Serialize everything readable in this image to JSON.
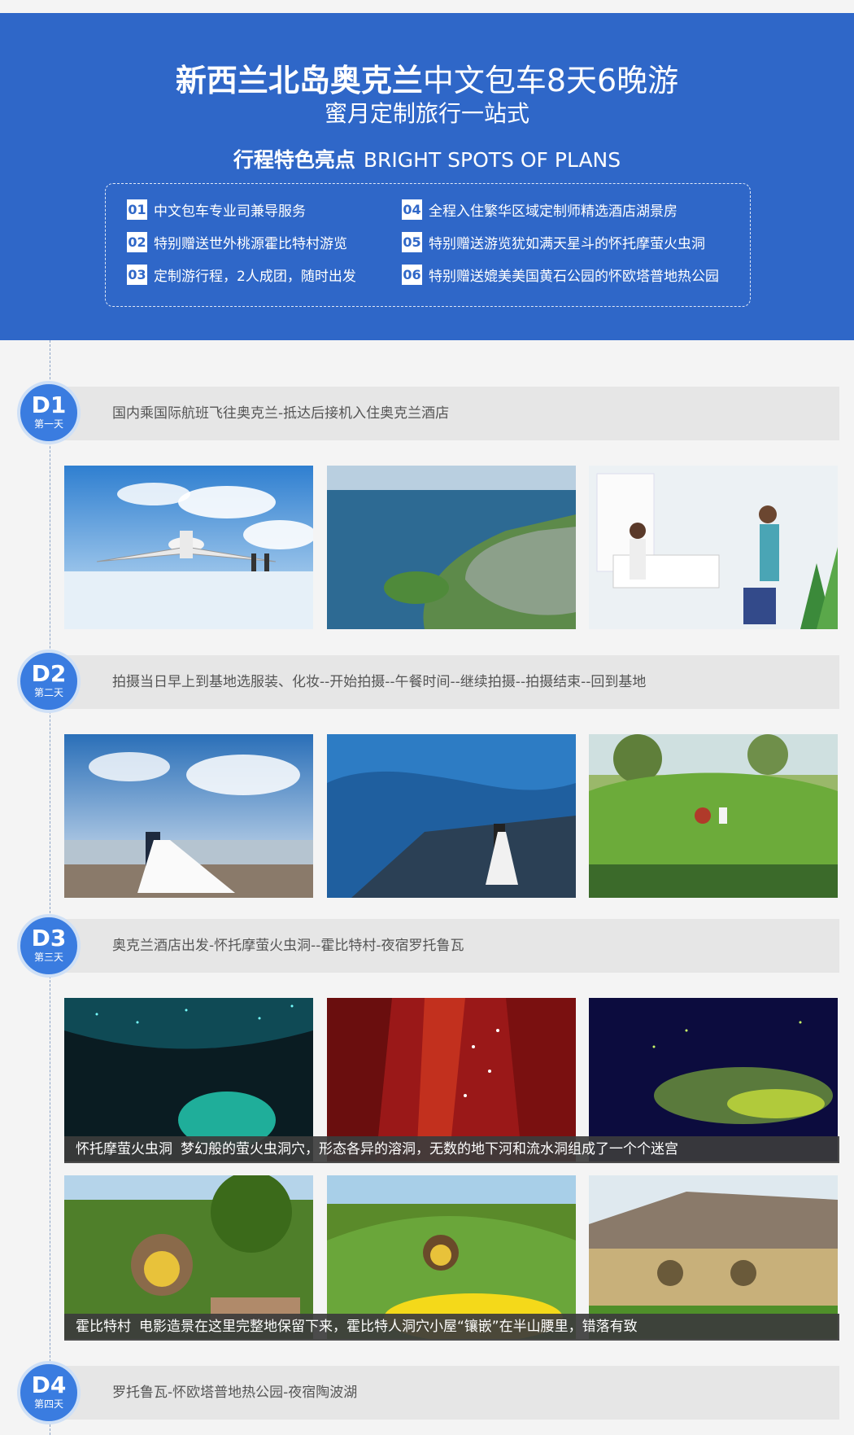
{
  "header": {
    "title_bold": "新西兰北岛奥克兰",
    "title_rest": "中文包车8天6晚游",
    "subtitle": "蜜月定制旅行一站式",
    "spots_cn": "行程特色亮点",
    "spots_en": "BRIGHT SPOTS OF PLANS"
  },
  "features": [
    {
      "num": "01",
      "text": "中文包车专业司兼导服务"
    },
    {
      "num": "02",
      "text": "特别赠送世外桃源霍比特村游览"
    },
    {
      "num": "03",
      "text": "定制游行程，2人成团，随时出发"
    },
    {
      "num": "04",
      "text": "全程入住繁华区域定制师精选酒店湖景房"
    },
    {
      "num": "05",
      "text": "特别赠送游览犹如满天星斗的怀托摩萤火虫洞"
    },
    {
      "num": "06",
      "text": "特别赠送媲美美国黄石公园的怀欧塔普地热公园"
    }
  ],
  "days": [
    {
      "code": "D1",
      "label": "第一天",
      "text": "国内乘国际航班飞往奥克兰-抵达后接机入住奥克兰酒店"
    },
    {
      "code": "D2",
      "label": "第二天",
      "text": "拍摄当日早上到基地选服装、化妆--开始拍摄--午餐时间--继续拍摄--拍摄结束--回到基地"
    },
    {
      "code": "D3",
      "label": "第三天",
      "text": "奥克兰酒店出发-怀托摩萤火虫洞--霍比特村-夜宿罗托鲁瓦"
    },
    {
      "code": "D4",
      "label": "第四天",
      "text": "罗托鲁瓦-怀欧塔普地热公园-夜宿陶波湖"
    }
  ],
  "captions": [
    {
      "title": "怀托摩萤火虫洞",
      "text": "梦幻般的萤火虫洞穴，形态各异的溶洞，无数的地下河和流水洞组成了一个个迷宫"
    },
    {
      "title": "霍比特村",
      "text": "电影造景在这里完整地保留下来，霍比特人洞穴小屋“镶嵌”在半山腰里，错落有致"
    }
  ],
  "colors": {
    "banner": "#2f67c8",
    "badge": "#3a7ce0"
  }
}
